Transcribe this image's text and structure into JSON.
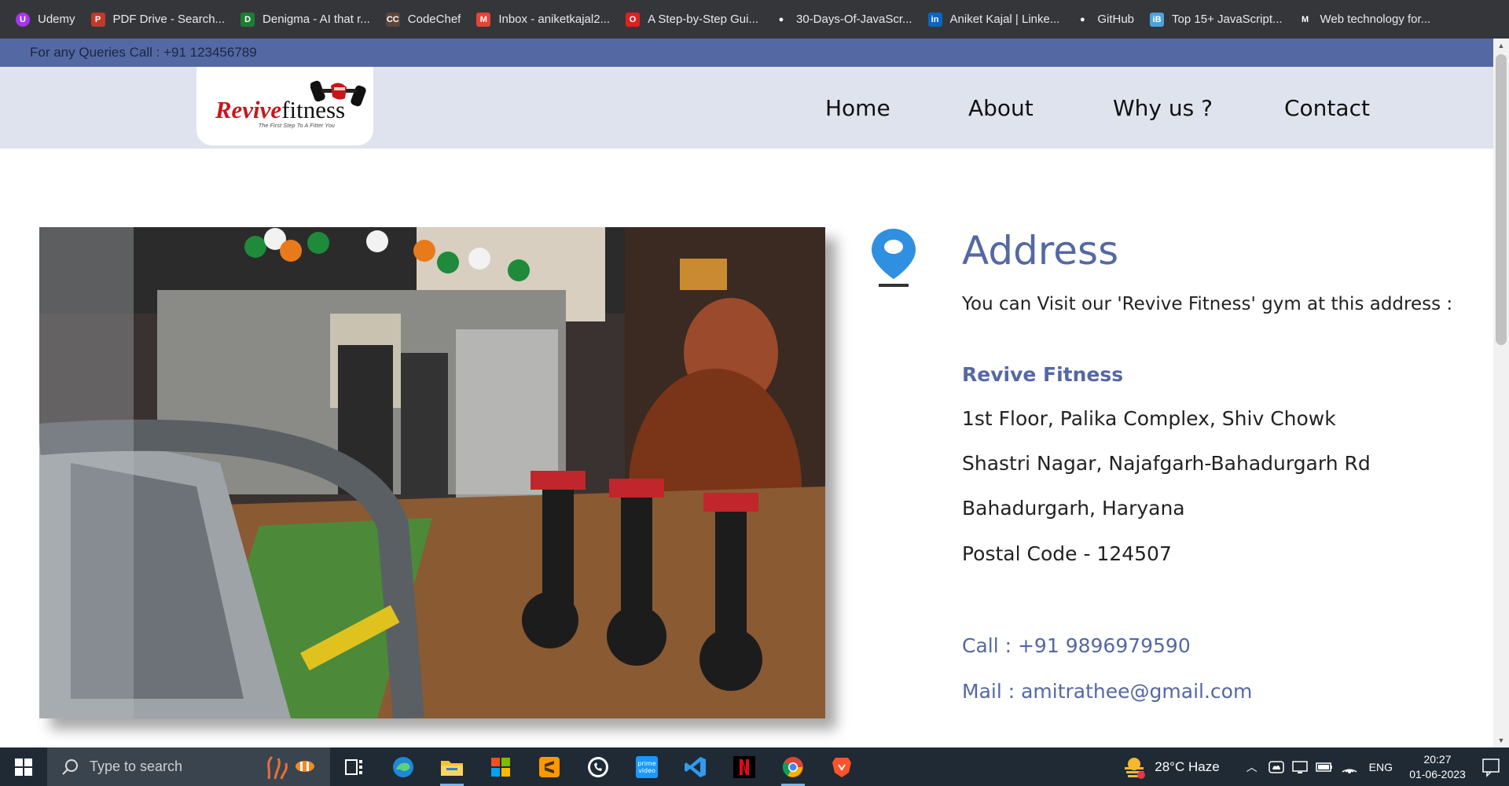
{
  "bookmarks": [
    {
      "label": "Udemy",
      "icon": "udemy-icon",
      "color": "#a435f0"
    },
    {
      "label": "PDF Drive - Search...",
      "icon": "pdfdrive-icon",
      "color": "#c0392b"
    },
    {
      "label": "Denigma - AI that r...",
      "icon": "denigma-icon",
      "color": "#1e7d34"
    },
    {
      "label": "CodeChef",
      "icon": "codechef-icon",
      "color": "#5b4638"
    },
    {
      "label": "Inbox - aniketkajal2...",
      "icon": "gmail-icon",
      "color": "#ea4335"
    },
    {
      "label": "A Step-by-Step Gui...",
      "icon": "opera-icon",
      "color": "#e0201f"
    },
    {
      "label": "30-Days-Of-JavaScr...",
      "icon": "github-icon",
      "color": "#ffffff"
    },
    {
      "label": "Aniket Kajal | Linke...",
      "icon": "linkedin-icon",
      "color": "#0a66c2"
    },
    {
      "label": "GitHub",
      "icon": "github-icon",
      "color": "#ffffff"
    },
    {
      "label": "Top 15+ JavaScript...",
      "icon": "interviewbit-icon",
      "color": "#4aa3df"
    },
    {
      "label": "Web technology for...",
      "icon": "mdn-icon",
      "color": "#ffffff"
    }
  ],
  "topstrip": {
    "text": "For any Queries Call : +91 123456789"
  },
  "logo": {
    "word_red": "Revive",
    "word_black": "fitness",
    "tagline": "The First Step To A Fitter You"
  },
  "nav": [
    "Home",
    "About",
    "Why us ?",
    "Contact"
  ],
  "address": {
    "title": "Address",
    "intro": "You can Visit our 'Revive Fitness' gym at this address :",
    "name": "Revive Fitness",
    "lines": [
      "1st Floor, Palika Complex, Shiv Chowk",
      "Shastri Nagar, Najafgarh-Bahadurgarh Rd",
      "Bahadurgarh, Haryana",
      "Postal Code - 124507"
    ],
    "call": "Call : +91 9896979590",
    "mail": "Mail : amitrathee@gmail.com"
  },
  "taskbar": {
    "search_placeholder": "Type to search",
    "weather": "28°C  Haze",
    "lang": "ENG",
    "time": "20:27",
    "date": "01-06-2023"
  }
}
